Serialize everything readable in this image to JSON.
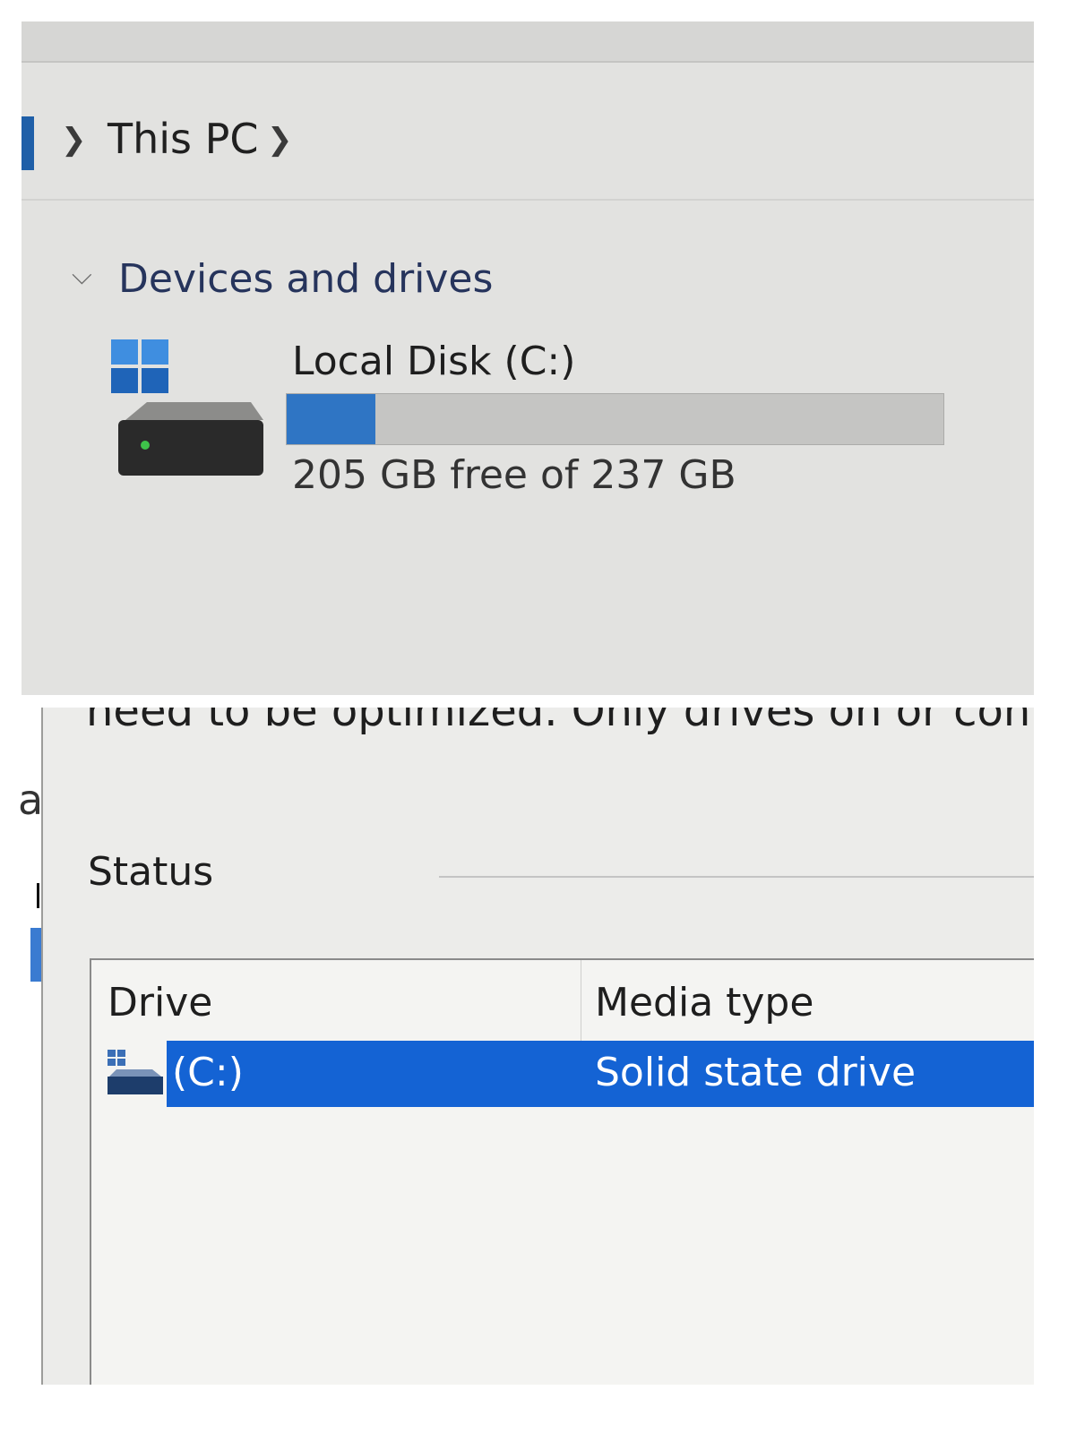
{
  "explorer": {
    "breadcrumb": {
      "location": "This PC"
    },
    "section": {
      "title": "Devices and drives"
    },
    "drive": {
      "name": "Local Disk (C:)",
      "free_text": "205 GB free of 237 GB",
      "used_fraction": 0.135
    }
  },
  "optimize": {
    "partial_text": "need to be optimized. Only drives on or conn",
    "left_edge_letter": "a",
    "status_label": "Status",
    "columns": {
      "drive": "Drive",
      "media_type": "Media type"
    },
    "rows": [
      {
        "drive": "(C:)",
        "media_type": "Solid state drive",
        "selected": true
      }
    ]
  },
  "colors": {
    "accent_blue": "#1463d4",
    "usage_bar_fill": "#2f75c4",
    "drive_led": "#3ec34a"
  },
  "icons": [
    "this-pc-icon",
    "chevron-right-icon",
    "chevron-down-icon",
    "drive-icon",
    "windows-logo-icon"
  ]
}
